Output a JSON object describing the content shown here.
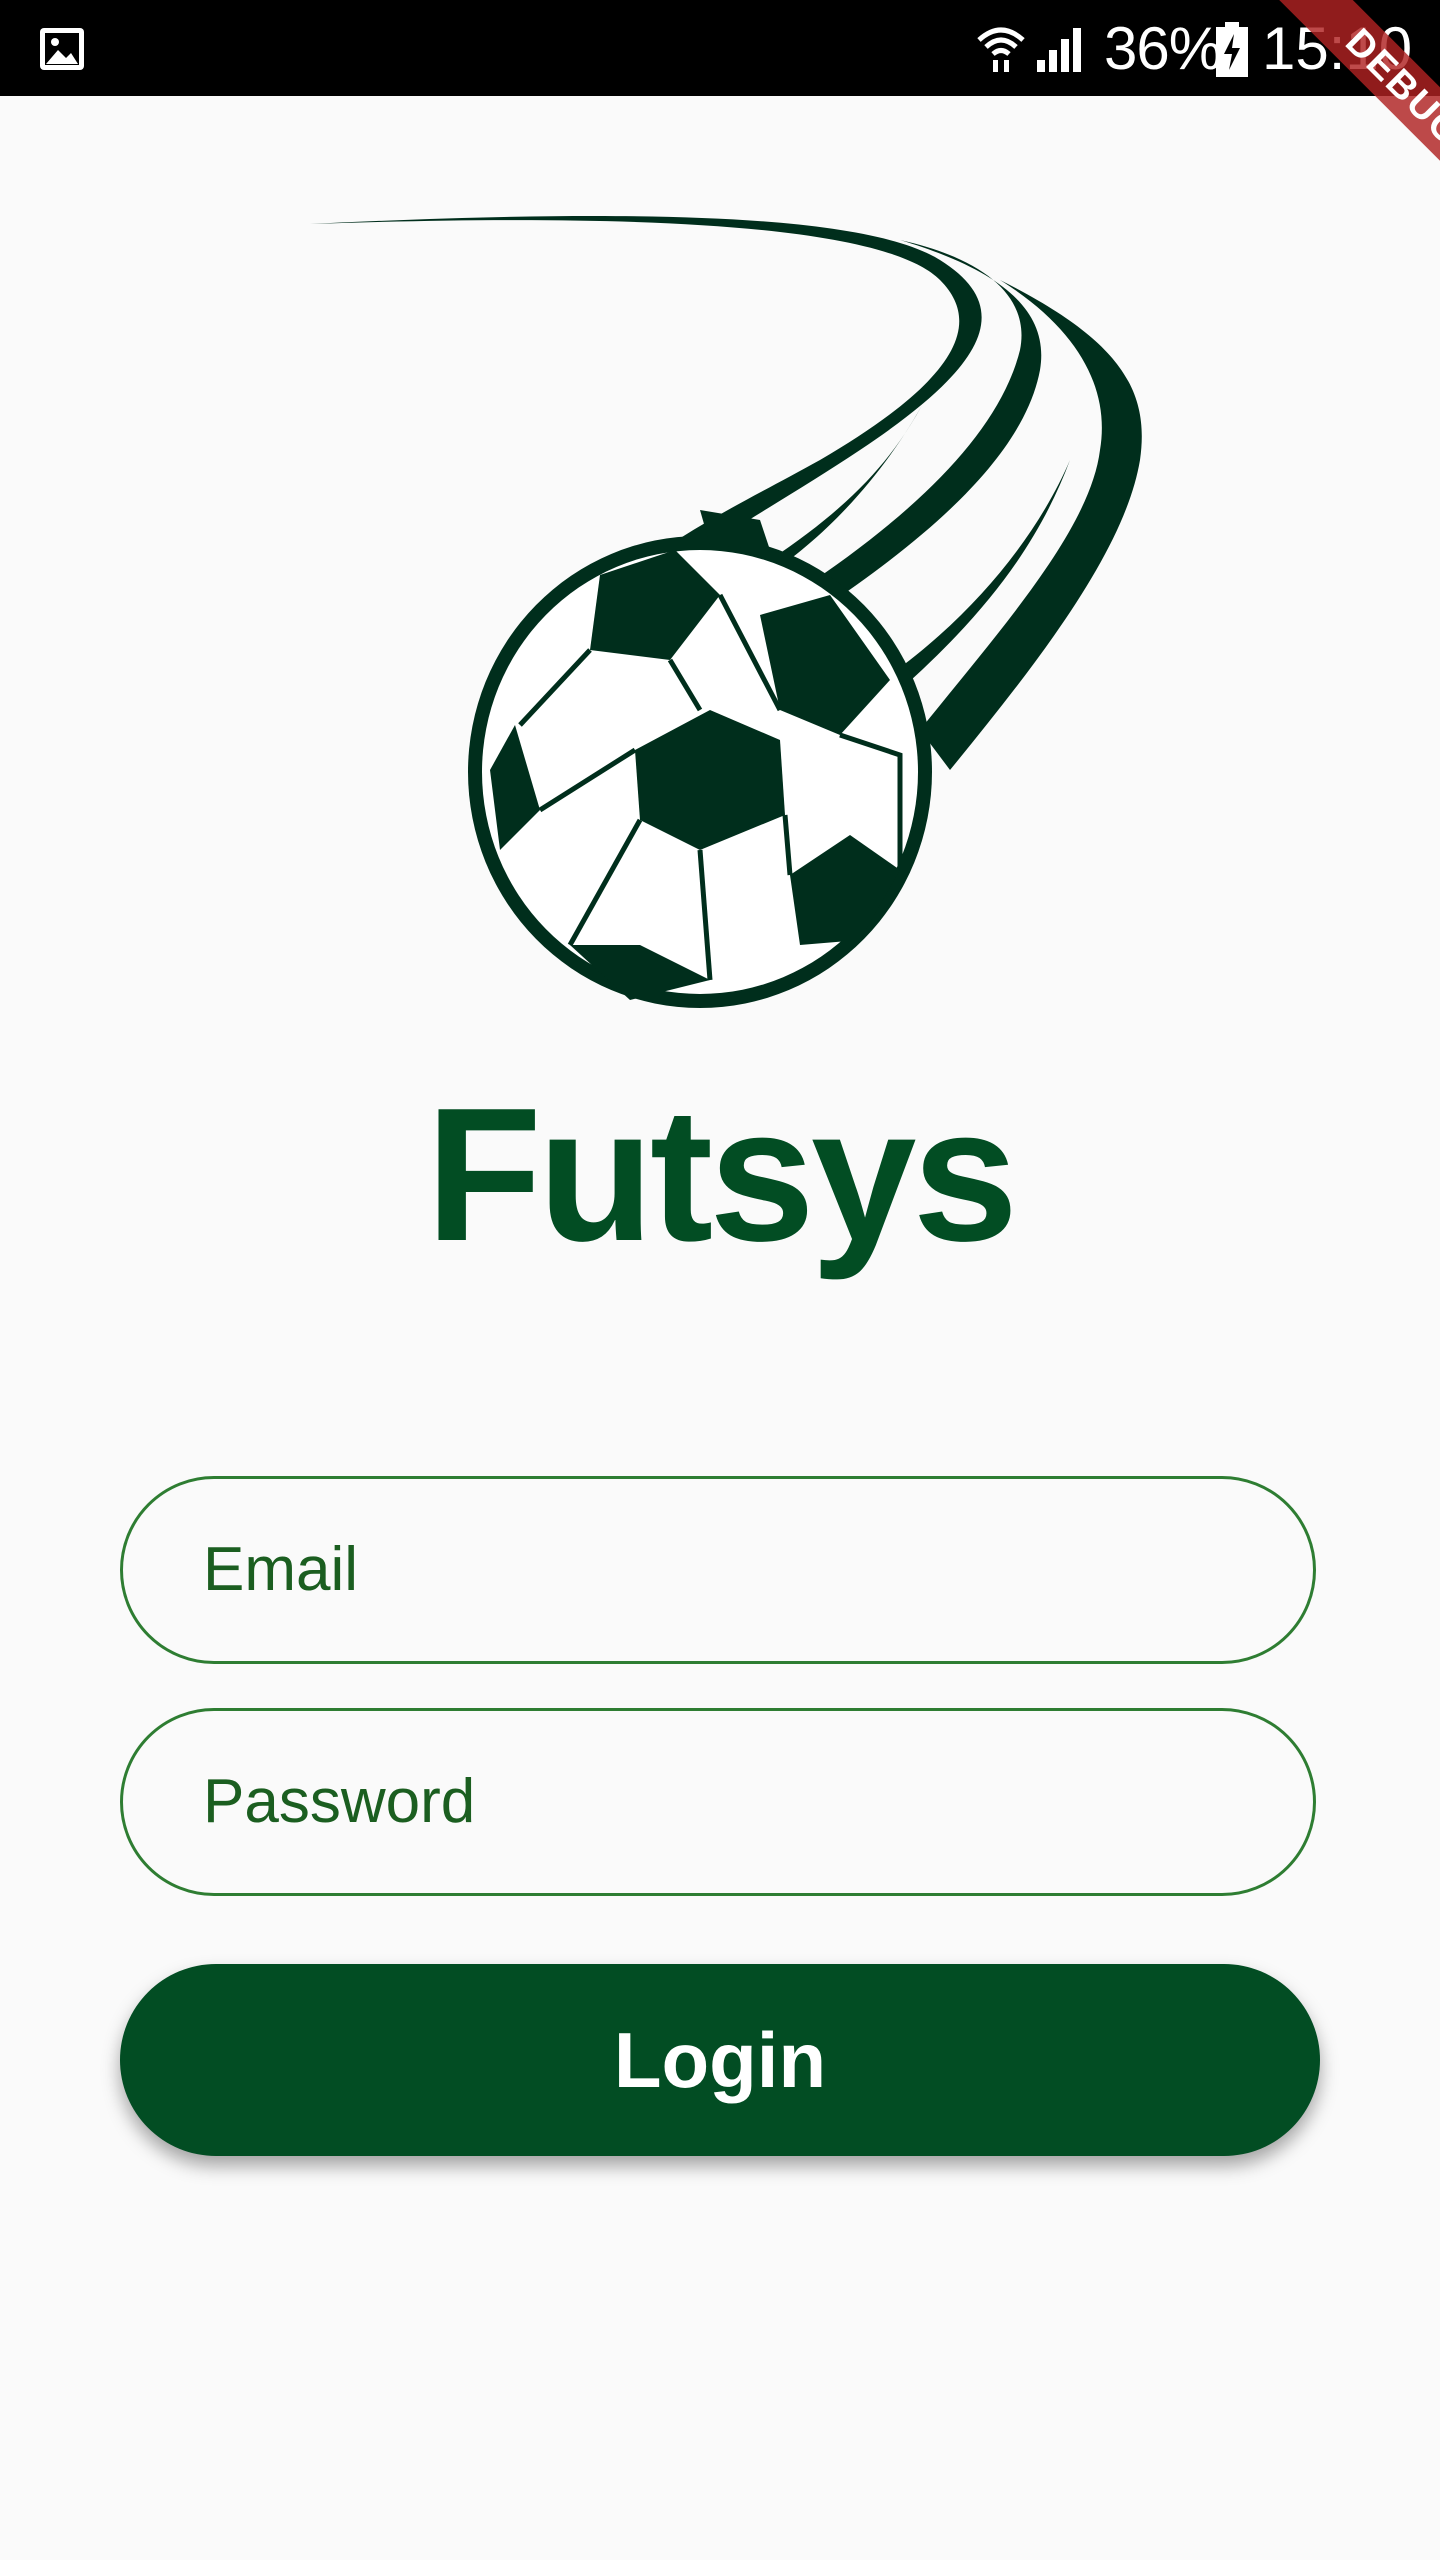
{
  "status_bar": {
    "battery_percent": "36%",
    "time": "15:10",
    "icons": [
      "gallery-icon",
      "wifi-icon",
      "signal-icon",
      "battery-charging-icon"
    ]
  },
  "debug_banner": {
    "label": "DEBUG"
  },
  "app": {
    "title": "Futsys"
  },
  "form": {
    "email_placeholder": "Email",
    "password_placeholder": "Password",
    "login_label": "Login"
  },
  "colors": {
    "brand_green": "#024d23",
    "field_border": "#2e7d32",
    "placeholder_text": "#1b5e20",
    "background": "#fafafa"
  }
}
